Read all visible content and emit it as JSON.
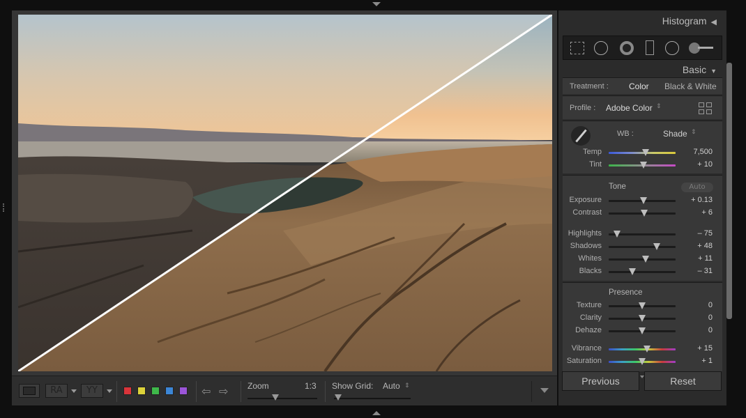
{
  "panel": {
    "histogram_label": "Histogram",
    "basic_label": "Basic",
    "treatment": {
      "label": "Treatment :",
      "options": [
        "Color",
        "Black & White"
      ],
      "selected": "Color"
    },
    "profile": {
      "label": "Profile :",
      "value": "Adobe Color"
    },
    "wb": {
      "label": "WB :",
      "value": "Shade",
      "temp": {
        "label": "Temp",
        "value": "7,500",
        "level": 0.55
      },
      "tint": {
        "label": "Tint",
        "value": "+ 10",
        "level": 0.52
      }
    },
    "tone": {
      "title": "Tone",
      "auto_label": "Auto",
      "exposure": {
        "label": "Exposure",
        "value": "+ 0.13",
        "level": 0.52
      },
      "contrast": {
        "label": "Contrast",
        "value": "+ 6",
        "level": 0.53
      },
      "highlights": {
        "label": "Highlights",
        "value": "– 75",
        "level": 0.13
      },
      "shadows": {
        "label": "Shadows",
        "value": "+ 48",
        "level": 0.72
      },
      "whites": {
        "label": "Whites",
        "value": "+ 11",
        "level": 0.55
      },
      "blacks": {
        "label": "Blacks",
        "value": "– 31",
        "level": 0.35
      }
    },
    "presence": {
      "title": "Presence",
      "texture": {
        "label": "Texture",
        "value": "0",
        "level": 0.5
      },
      "clarity": {
        "label": "Clarity",
        "value": "0",
        "level": 0.5
      },
      "dehaze": {
        "label": "Dehaze",
        "value": "0",
        "level": 0.5
      },
      "vibrance": {
        "label": "Vibrance",
        "value": "+ 15",
        "level": 0.57
      },
      "saturation": {
        "label": "Saturation",
        "value": "+ 1",
        "level": 0.5
      }
    },
    "previous_label": "Previous",
    "reset_label": "Reset"
  },
  "toolbar": {
    "ra_label": "RA",
    "yy_label": "YY",
    "zoom_label": "Zoom",
    "zoom_value": "1:3",
    "zoom_level": 0.4,
    "grid_label": "Show Grid:",
    "grid_value": "Auto",
    "grid_level": 0.0,
    "color_labels": [
      "#d9343a",
      "#dcd23a",
      "#3fb84a",
      "#3c86d6",
      "#9b55d8"
    ]
  }
}
